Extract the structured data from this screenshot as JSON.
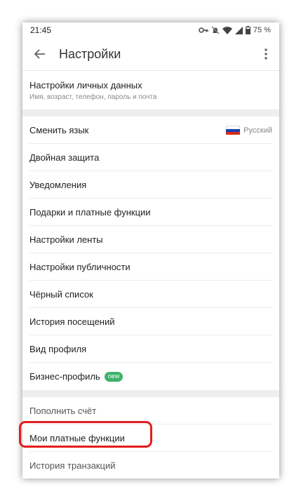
{
  "status_bar": {
    "time": "21:45",
    "battery": "75 %"
  },
  "toolbar": {
    "title": "Настройки"
  },
  "profile": {
    "title": "Настройки личных данных",
    "subtitle": "Имя, возраст, телефон, пароль и почта"
  },
  "settings": {
    "language_label": "Сменить язык",
    "language_value": "Русский",
    "items": [
      "Двойная защита",
      "Уведомления",
      "Подарки и платные функции",
      "Настройки ленты",
      "Настройки публичности",
      "Чёрный список",
      "История посещений",
      "Вид профиля"
    ],
    "business_label": "Бизнес-профиль",
    "business_badge": "new"
  },
  "payments": {
    "items": [
      "Пополнить счёт",
      "Мои платные функции",
      "История транзакций"
    ]
  },
  "colors": {
    "highlight": "#e31c1c",
    "badge": "#3db26b"
  },
  "icons": [
    "key-icon",
    "bell-off-icon",
    "wifi-icon",
    "signal-icon",
    "battery-icon",
    "back-arrow-icon",
    "more-vert-icon",
    "russian-flag-icon"
  ]
}
